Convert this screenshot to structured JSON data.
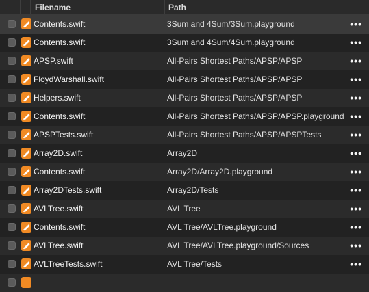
{
  "columns": {
    "filename": "Filename",
    "path": "Path"
  },
  "more_label": "•••",
  "accent_color": "#f08a24",
  "rows": [
    {
      "filename": "Contents.swift",
      "path": "3Sum and 4Sum/3Sum.playground",
      "selected": true
    },
    {
      "filename": "Contents.swift",
      "path": "3Sum and 4Sum/4Sum.playground"
    },
    {
      "filename": "APSP.swift",
      "path": "All-Pairs Shortest Paths/APSP/APSP"
    },
    {
      "filename": "FloydWarshall.swift",
      "path": "All-Pairs Shortest Paths/APSP/APSP"
    },
    {
      "filename": "Helpers.swift",
      "path": "All-Pairs Shortest Paths/APSP/APSP"
    },
    {
      "filename": "Contents.swift",
      "path": "All-Pairs Shortest Paths/APSP/APSP.playground"
    },
    {
      "filename": "APSPTests.swift",
      "path": "All-Pairs Shortest Paths/APSP/APSPTests"
    },
    {
      "filename": "Array2D.swift",
      "path": "Array2D"
    },
    {
      "filename": "Contents.swift",
      "path": "Array2D/Array2D.playground"
    },
    {
      "filename": "Array2DTests.swift",
      "path": "Array2D/Tests"
    },
    {
      "filename": "AVLTree.swift",
      "path": "AVL Tree"
    },
    {
      "filename": "Contents.swift",
      "path": "AVL Tree/AVLTree.playground"
    },
    {
      "filename": "AVLTree.swift",
      "path": "AVL Tree/AVLTree.playground/Sources"
    },
    {
      "filename": "AVLTreeTests.swift",
      "path": "AVL Tree/Tests"
    },
    {
      "filename": "",
      "path": ""
    }
  ]
}
